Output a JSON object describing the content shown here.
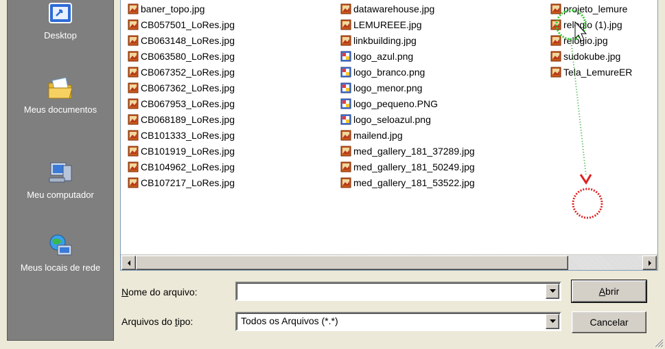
{
  "places": [
    {
      "label": "Desktop",
      "icon": "desktop-icon"
    },
    {
      "label": "Meus documentos",
      "icon": "folder-documents-icon"
    },
    {
      "label": "Meu computador",
      "icon": "computer-icon"
    },
    {
      "label": "Meus locais de rede",
      "icon": "network-icon"
    }
  ],
  "files": {
    "column1": [
      {
        "name": "baner_topo.jpg",
        "type": "jpg"
      },
      {
        "name": "CB057501_LoRes.jpg",
        "type": "jpg"
      },
      {
        "name": "CB063148_LoRes.jpg",
        "type": "jpg"
      },
      {
        "name": "CB063580_LoRes.jpg",
        "type": "jpg"
      },
      {
        "name": "CB067352_LoRes.jpg",
        "type": "jpg"
      },
      {
        "name": "CB067362_LoRes.jpg",
        "type": "jpg"
      },
      {
        "name": "CB067953_LoRes.jpg",
        "type": "jpg"
      },
      {
        "name": "CB068189_LoRes.jpg",
        "type": "jpg"
      },
      {
        "name": "CB101333_LoRes.jpg",
        "type": "jpg"
      },
      {
        "name": "CB101919_LoRes.jpg",
        "type": "jpg"
      },
      {
        "name": "CB104962_LoRes.jpg",
        "type": "jpg"
      },
      {
        "name": "CB107217_LoRes.jpg",
        "type": "jpg"
      }
    ],
    "column2": [
      {
        "name": "datawarehouse.jpg",
        "type": "jpg"
      },
      {
        "name": "LEMUREEE.jpg",
        "type": "jpg"
      },
      {
        "name": "linkbuilding.jpg",
        "type": "jpg"
      },
      {
        "name": "logo_azul.png",
        "type": "png"
      },
      {
        "name": "logo_branco.png",
        "type": "png"
      },
      {
        "name": "logo_menor.png",
        "type": "png"
      },
      {
        "name": "logo_pequeno.PNG",
        "type": "png"
      },
      {
        "name": "logo_seloazul.png",
        "type": "png"
      },
      {
        "name": "mailend.jpg",
        "type": "jpg"
      },
      {
        "name": "med_gallery_181_37289.jpg",
        "type": "jpg"
      },
      {
        "name": "med_gallery_181_50249.jpg",
        "type": "jpg"
      },
      {
        "name": "med_gallery_181_53522.jpg",
        "type": "jpg"
      }
    ],
    "column3": [
      {
        "name": "projeto_lemure",
        "type": "jpg"
      },
      {
        "name": "relogio (1).jpg",
        "type": "jpg"
      },
      {
        "name": "relogio.jpg",
        "type": "jpg"
      },
      {
        "name": "sudokube.jpg",
        "type": "jpg"
      },
      {
        "name": "Tela_LemureER",
        "type": "jpg"
      }
    ]
  },
  "filename": {
    "label_prefix": "",
    "label_access": "N",
    "label_rest": "ome do arquivo:",
    "value": ""
  },
  "filetype": {
    "label_prefix": "Arquivos do ",
    "label_access": "t",
    "label_rest": "ipo:",
    "value": "Todos os Arquivos (*.*)"
  },
  "buttons": {
    "open_access": "A",
    "open_rest": "brir",
    "cancel": "Cancelar"
  },
  "colors": {
    "places_bg": "#7f7f7f",
    "dialog_bg": "#ece9d8",
    "drag_start": "#33cc33",
    "drag_end": "#dd2222"
  }
}
